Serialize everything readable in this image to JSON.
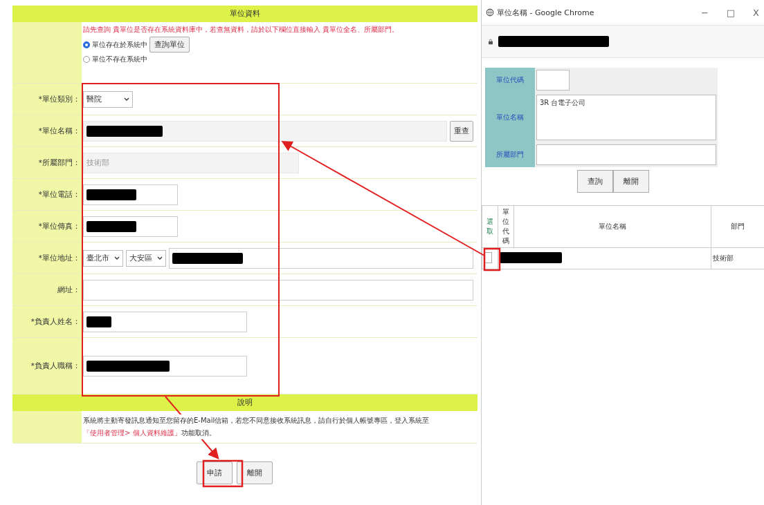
{
  "form": {
    "title": "單位資料",
    "notice": "請先查詢 貴單位是否存在系統資料庫中，若查無資料，請於以下欄位直接輸入 貴單位全名、所屬部門。",
    "radios": [
      {
        "label": "單位存在於系統中",
        "selected": true,
        "button": "查詢單位"
      },
      {
        "label": "單位不存在系統中",
        "selected": false
      }
    ],
    "fields": [
      {
        "kind": "select",
        "label": "*單位類別：",
        "value": "醫院"
      },
      {
        "kind": "lookup",
        "label": "*單位名稱：",
        "redacted": true,
        "button": "重查"
      },
      {
        "kind": "readonly",
        "label": "*所屬部門：",
        "value": "技術部",
        "disabled": true
      },
      {
        "kind": "short",
        "label": "*單位電話：",
        "redacted": true
      },
      {
        "kind": "short",
        "label": "*單位傳真：",
        "redacted": true
      },
      {
        "kind": "address",
        "label": "*單位地址：",
        "selects": [
          "臺北市",
          "大安區"
        ],
        "redacted": true
      },
      {
        "kind": "wide",
        "label": "網址：",
        "redacted": false
      },
      {
        "kind": "medium",
        "label": "*負責人姓名：",
        "redacted": true
      },
      {
        "kind": "medium",
        "label": "*負責人職稱：",
        "redacted": true
      }
    ]
  },
  "notes": {
    "title": "說明",
    "text": "系統將主動寄發訊息通知至您留存的E-Mail信箱，若您不同意接收系統訊息，請自行於個人帳號專區，登入系統至",
    "link": "「使用者管理> 個人資料維護」",
    "end": "功能取消。"
  },
  "buttons": [
    "申請",
    "離開"
  ],
  "popup": {
    "title": "單位名稱 - Google Chrome",
    "controls": [
      "−",
      "□",
      "X"
    ],
    "fields": [
      {
        "kind": "input",
        "label": "單位代碼"
      },
      {
        "kind": "textarea",
        "label": "單位名稱",
        "value": "3R 台電子公司"
      },
      {
        "kind": "input",
        "label": "所屬部門"
      }
    ],
    "buttons": [
      "查詢",
      "離開"
    ],
    "table": {
      "columns": [
        "選取",
        "單位代碼",
        "單位名稱",
        "部門"
      ],
      "rows": [
        {
          "checked": false,
          "redacted": true,
          "department": "技術部"
        }
      ]
    }
  }
}
